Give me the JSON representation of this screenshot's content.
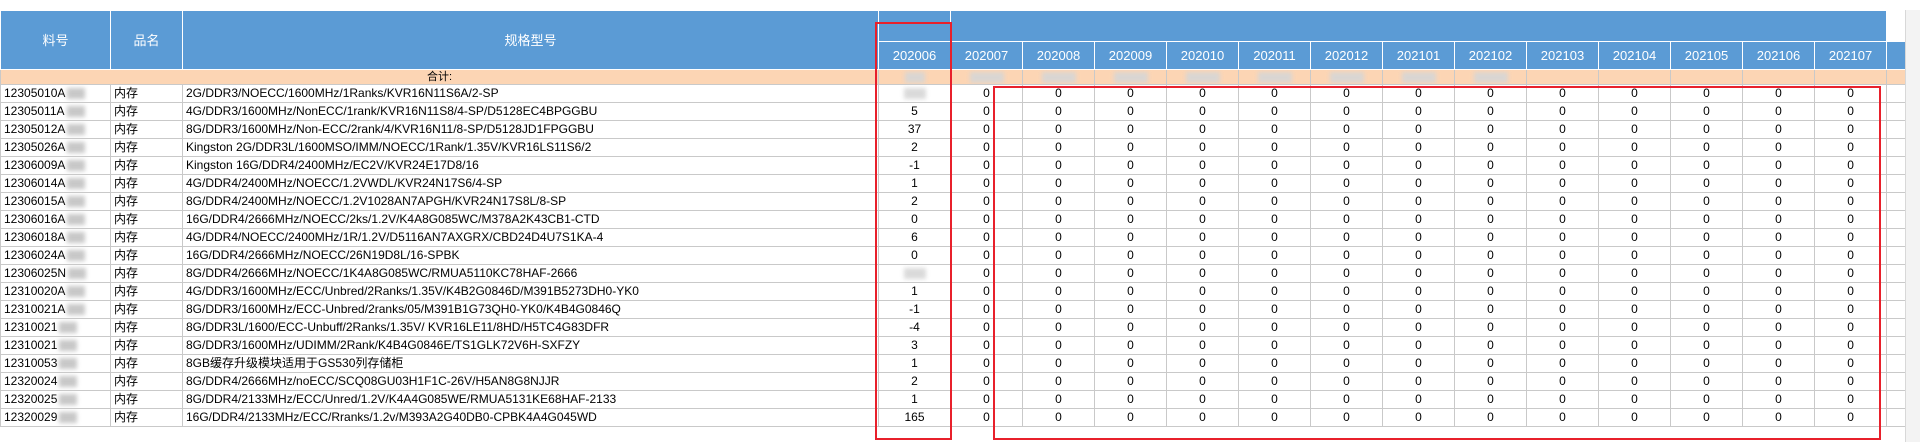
{
  "headers": {
    "part_no": "料号",
    "name": "品名",
    "spec": "规格型号",
    "periods": [
      "202006",
      "202007",
      "202008",
      "202009",
      "202010",
      "202011",
      "202012",
      "202101",
      "202102",
      "202103",
      "202104",
      "202105",
      "202106",
      "202107"
    ]
  },
  "summary_label": "合计:",
  "rows": [
    {
      "part": "12305010A",
      "name": "内存",
      "spec": "2G/DDR3/NOECC/1600MHz/1Ranks/KVR16N11S6A/2-SP",
      "first": ""
    },
    {
      "part": "12305011A",
      "name": "内存",
      "spec": "4G/DDR3/1600MHz/NonECC/1rank/KVR16N11S8/4-SP/D5128EC4BPGGBU",
      "first": "5"
    },
    {
      "part": "12305012A",
      "name": "内存",
      "spec": "8G/DDR3/1600MHz/Non-ECC/2rank/4/KVR16N11/8-SP/D5128JD1FPGGBU",
      "first": "37"
    },
    {
      "part": "12305026A",
      "name": "内存",
      "spec": "Kingston 2G/DDR3L/1600MSO/IMM/NOECC/1Rank/1.35V/KVR16LS11S6/2",
      "first": "2"
    },
    {
      "part": "12306009A",
      "name": "内存",
      "spec": "Kingston 16G/DDR4/2400MHz/EC2V/KVR24E17D8/16",
      "first": "-1"
    },
    {
      "part": "12306014A",
      "name": "内存",
      "spec": "4G/DDR4/2400MHz/NOECC/1.2VWDL/KVR24N17S6/4-SP",
      "first": "1"
    },
    {
      "part": "12306015A",
      "name": "内存",
      "spec": "8G/DDR4/2400MHz/NOECC/1.2V1028AN7APGH/KVR24N17S8L/8-SP",
      "first": "2"
    },
    {
      "part": "12306016A",
      "name": "内存",
      "spec": "16G/DDR4/2666MHz/NOECC/2ks/1.2V/K4A8G085WC/M378A2K43CB1-CTD",
      "first": "0"
    },
    {
      "part": "12306018A",
      "name": "内存",
      "spec": "4G/DDR4/NOECC/2400MHz/1R/1.2V/D5116AN7AXGRX/CBD24D4U7S1KA-4",
      "first": "6"
    },
    {
      "part": "12306024A",
      "name": "内存",
      "spec": "16G/DDR4/2666MHz/NOECC/26N19D8L/16-SPBK",
      "first": "0"
    },
    {
      "part": "12306025N",
      "name": "内存",
      "spec": "8G/DDR4/2666MHz/NOECC/1K4A8G085WC/RMUA5110KC78HAF-2666",
      "first": ""
    },
    {
      "part": "12310020A",
      "name": "内存",
      "spec": "4G/DDR3/1600MHz/ECC/Unbred/2Ranks/1.35V/K4B2G0846D/M391B5273DH0-YK0",
      "first": "1"
    },
    {
      "part": "12310021A",
      "name": "内存",
      "spec": "8G/DDR3/1600MHz/ECC-Unbred/2ranks/05/M391B1G73QH0-YK0/K4B4G0846Q",
      "first": "-1"
    },
    {
      "part": "12310021",
      "name": "内存",
      "spec": "8G/DDR3L/1600/ECC-Unbuff/2Ranks/1.35V/ KVR16LE11/8HD/H5TC4G83DFR",
      "first": "-4"
    },
    {
      "part": "12310021",
      "name": "内存",
      "spec": "8G/DDR3/1600MHz/UDIMM/2Rank/K4B4G0846E/TS1GLK72V6H-SXFZY",
      "first": "3"
    },
    {
      "part": "12310053",
      "name": "内存",
      "spec": "8GB缓存升级模块适用于GS530列存储柜",
      "first": "1"
    },
    {
      "part": "12320024",
      "name": "内存",
      "spec": "8G/DDR4/2666MHz/noECC/SCQ08GU03H1F1C-26V/H5AN8G8NJJR",
      "first": "2"
    },
    {
      "part": "12320025",
      "name": "内存",
      "spec": "8G/DDR4/2133MHz/ECC/Unred/1.2V/K4A4G085WE/RMUA5131KE68HAF-2133",
      "first": "1"
    },
    {
      "part": "12320029",
      "name": "内存",
      "spec": "16G/DDR4/2133MHz/ECC/Rranks/1.2v/M393A2G40DB0-CPBK4A4G045WD",
      "first": "165"
    }
  ],
  "zero_value": "0",
  "colors": {
    "header_bg": "#5b9bd5",
    "summary_bg": "#fcd5b4",
    "highlight_border": "#e8202b"
  }
}
